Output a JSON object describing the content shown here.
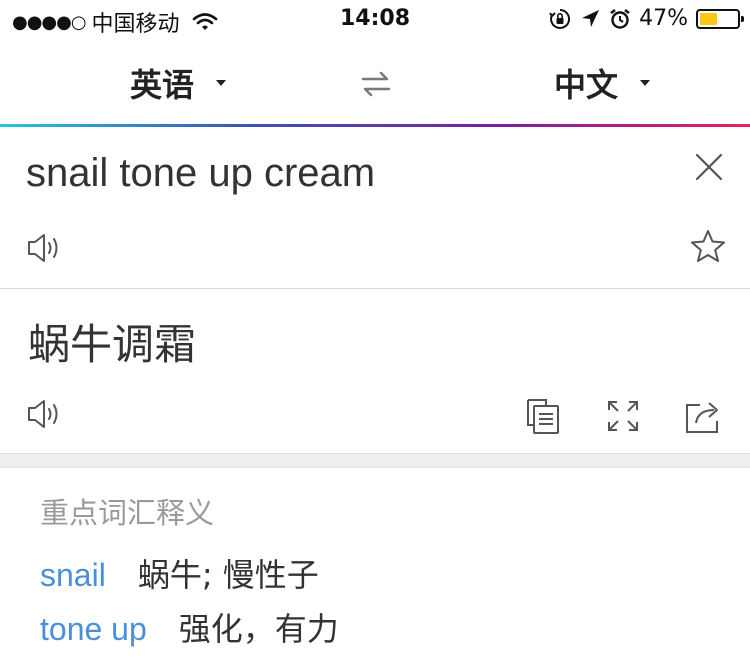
{
  "status_bar": {
    "signal": "●●●●○",
    "carrier": "中国移动",
    "time": "14:08",
    "battery_percent": "47%",
    "battery_level": 0.47,
    "battery_color": "#f8c816",
    "icons": [
      "wifi-icon",
      "orientation-lock-icon",
      "location-arrow-icon",
      "alarm-icon",
      "battery-icon"
    ]
  },
  "language_bar": {
    "source_language": "英语",
    "target_language": "中文",
    "swap_icon": "swap-arrows-icon",
    "gradient_colors": [
      "#26c6da",
      "#3f51b5",
      "#7b1fa2",
      "#e91e63"
    ]
  },
  "source": {
    "text": "snail tone up cream",
    "icons": [
      "close-icon",
      "speaker-icon",
      "star-icon"
    ]
  },
  "result": {
    "text": "蜗牛调霜",
    "icons": [
      "speaker-icon",
      "copy-icon",
      "fullscreen-icon",
      "share-icon"
    ]
  },
  "vocabulary": {
    "title": "重点词汇释义",
    "word_color": "#4a90d9",
    "items": [
      {
        "word": "snail",
        "definition": "蜗牛; 慢性子"
      },
      {
        "word": "tone up",
        "definition": "强化，有力"
      }
    ]
  }
}
